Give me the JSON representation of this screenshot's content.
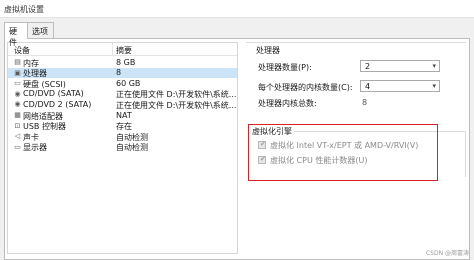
{
  "window": {
    "title": "虚拟机设置"
  },
  "tabs": [
    {
      "label": "硬件"
    },
    {
      "label": "选项"
    }
  ],
  "device_list": {
    "headers": {
      "device": "设备",
      "summary": "摘要"
    },
    "rows": [
      {
        "icon": "memory-icon",
        "glyph": "▤",
        "name": "内存",
        "summary": "8 GB"
      },
      {
        "icon": "processor-icon",
        "glyph": "▣",
        "name": "处理器",
        "summary": "8"
      },
      {
        "icon": "hard-disk-icon",
        "glyph": "▭",
        "name": "硬盘 (SCSI)",
        "summary": "60 GB"
      },
      {
        "icon": "cd-dvd-icon",
        "glyph": "◉",
        "name": "CD/DVD (SATA)",
        "summary": "正在使用文件 D:\\开发软件\\系统..."
      },
      {
        "icon": "cd-dvd-icon",
        "glyph": "◉",
        "name": "CD/DVD 2 (SATA)",
        "summary": "正在使用文件 D:\\开发软件\\系统..."
      },
      {
        "icon": "network-adapter-icon",
        "glyph": "▦",
        "name": "网络适配器",
        "summary": "NAT"
      },
      {
        "icon": "usb-controller-icon",
        "glyph": "⊡",
        "name": "USB 控制器",
        "summary": "存在"
      },
      {
        "icon": "sound-card-icon",
        "glyph": "◁",
        "name": "声卡",
        "summary": "自动检测"
      },
      {
        "icon": "display-icon",
        "glyph": "▭",
        "name": "显示器",
        "summary": "自动检测"
      }
    ]
  },
  "processor": {
    "section_title": "处理器",
    "count_label": "处理器数量(P):",
    "count_value": "2",
    "cores_label": "每个处理器的内核数量(C):",
    "cores_value": "4",
    "total_label": "处理器内核总数:",
    "total_value": "8"
  },
  "virtualization": {
    "section_title": "虚拟化引擎",
    "option1": "虚拟化 Intel VT-x/EPT 或 AMD-V/RVI(V)",
    "option2": "虚拟化 CPU 性能计数器(U)",
    "option1_checked": true,
    "option2_checked": true
  },
  "watermark": "CSDN @周富涛",
  "colors": {
    "selected_row": "#cce4f7",
    "highlight_box": "#e02020"
  }
}
